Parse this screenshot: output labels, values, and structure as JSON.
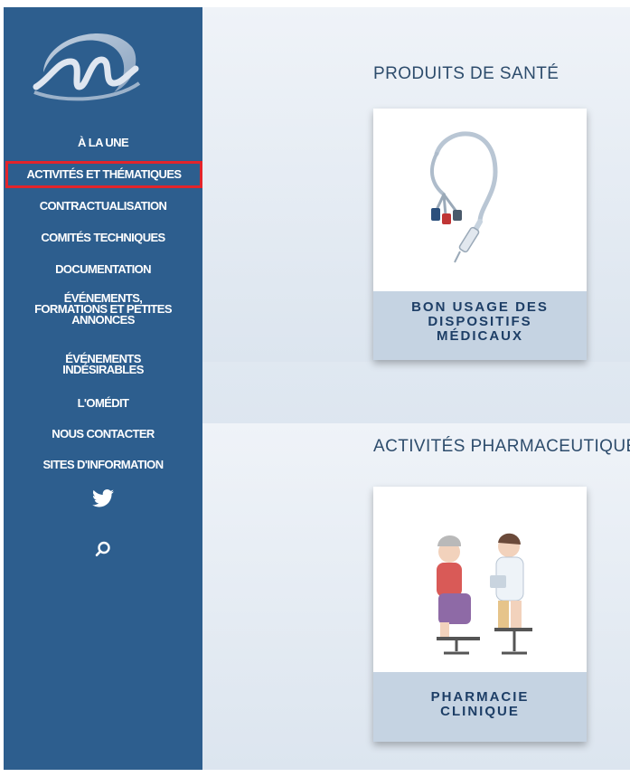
{
  "sidebar": {
    "logo_name": "omedit-logo",
    "nav_items": [
      {
        "lines": [
          "À LA UNE"
        ]
      },
      {
        "lines": [
          "ACTIVITÉS ET THÉMATIQUES"
        ],
        "active": true
      },
      {
        "lines": [
          "CONTRACTUALISATION"
        ]
      },
      {
        "lines": [
          "COMITÉS TECHNIQUES"
        ]
      },
      {
        "lines": [
          "DOCUMENTATION"
        ]
      },
      {
        "lines": [
          "ÉVÉNEMENTS,",
          "FORMATIONS ET PETITES",
          "ANNONCES"
        ]
      },
      {
        "lines": [
          "ÉVÉNEMENTS",
          "INDÉSIRABLES"
        ]
      },
      {
        "lines": [
          "L'OMÉDIT"
        ]
      },
      {
        "lines": [
          "NOUS CONTACTER"
        ]
      },
      {
        "lines": [
          "SITES D'INFORMATION"
        ]
      }
    ],
    "social_icon": "twitter-icon",
    "search_icon": "search-icon"
  },
  "main": {
    "sections": [
      {
        "title": "PRODUITS DE SANTÉ",
        "card": {
          "image": "catheter-syringe-illustration",
          "label_lines": [
            "BON USAGE DES",
            "DISPOSITIFS",
            "MÉDICAUX"
          ]
        }
      },
      {
        "title": "ACTIVITÉS PHARMACEUTIQUES",
        "card": {
          "image": "patient-pharmacist-illustration",
          "label_lines": [
            "PHARMACIE",
            "CLINIQUE"
          ]
        }
      }
    ]
  },
  "colors": {
    "sidebar_bg": "#2d5e8e",
    "active_outline": "#e3242b",
    "card_label_bg": "#c5d3e2",
    "card_label_text": "#1d3e66",
    "section_title": "#2d4c6c"
  }
}
